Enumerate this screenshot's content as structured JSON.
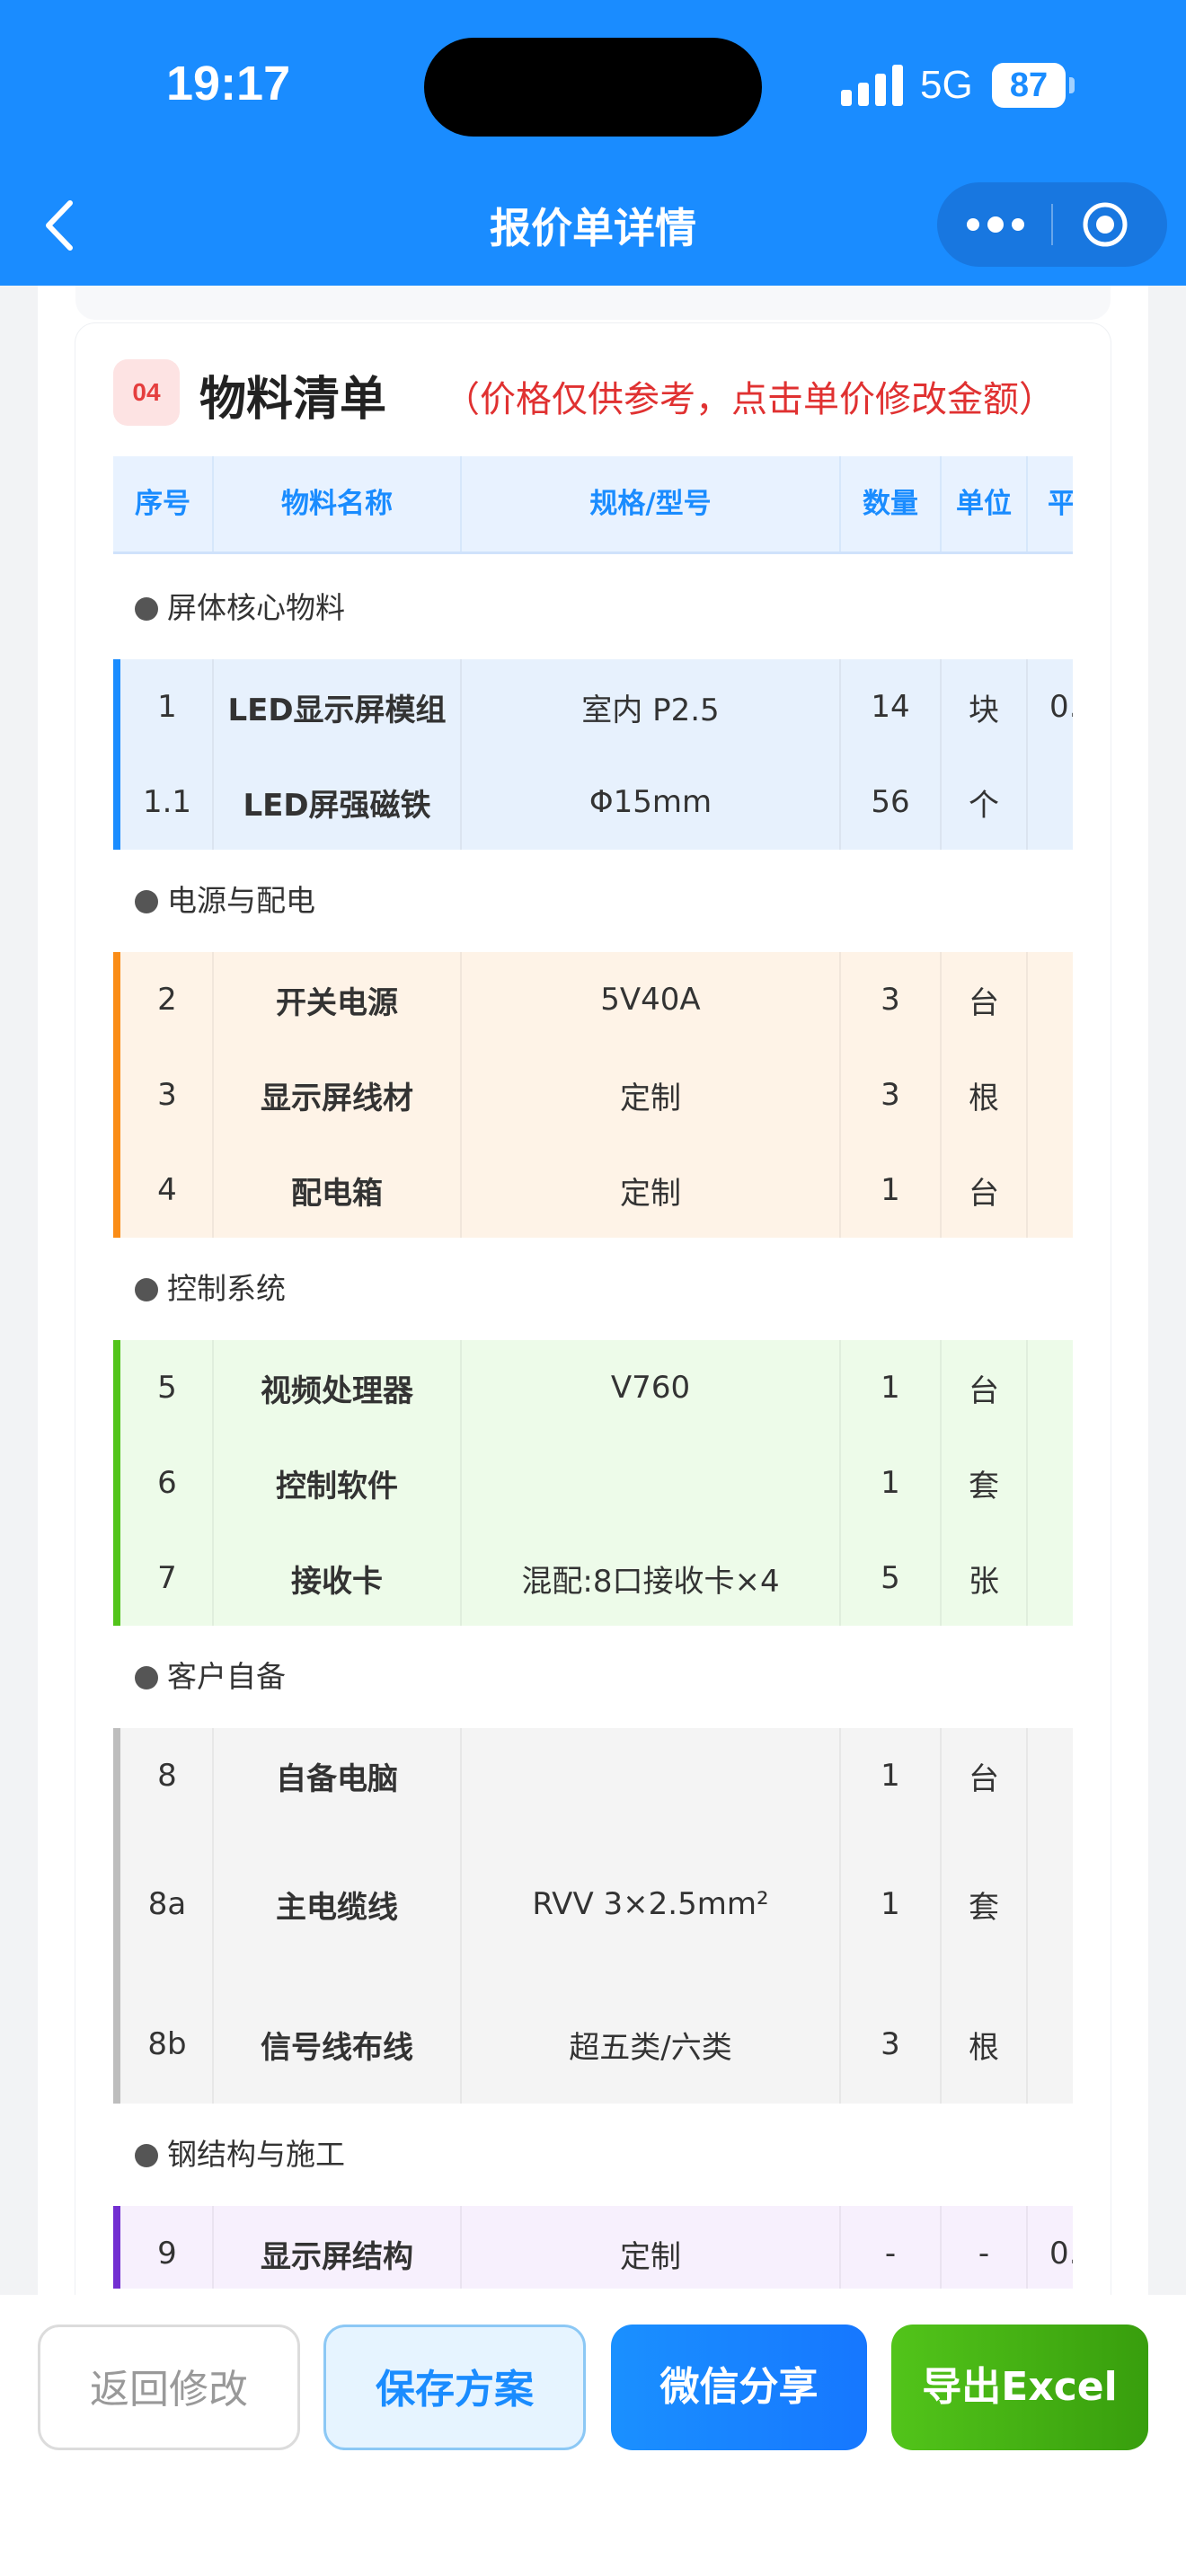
{
  "status": {
    "time": "19:17",
    "network": "5G",
    "battery": "87"
  },
  "nav": {
    "title": "报价单详情"
  },
  "section": {
    "badge": "04",
    "title": "物料清单",
    "note": "（价格仅供参考，点击单价修改金额）",
    "columns": [
      "序号",
      "物料名称",
      "规格/型号",
      "数量",
      "单位",
      "平"
    ]
  },
  "groups": [
    {
      "label": "屏体核心物料",
      "accent": "#1a8cff",
      "bg": "#e7f1fd",
      "rows": [
        {
          "no": "1",
          "name": "LED显示屏模组",
          "spec": "室内 P2.5",
          "qty": "14",
          "unit": "块",
          "price": "0."
        },
        {
          "no": "1.1",
          "name": "LED屏强磁铁",
          "spec": "Φ15mm",
          "qty": "56",
          "unit": "个",
          "price": ""
        }
      ]
    },
    {
      "label": "电源与配电",
      "accent": "#fa8c16",
      "bg": "#fef3e7",
      "rows": [
        {
          "no": "2",
          "name": "开关电源",
          "spec": "5V40A",
          "qty": "3",
          "unit": "台",
          "price": ""
        },
        {
          "no": "3",
          "name": "显示屏线材",
          "spec": "定制",
          "qty": "3",
          "unit": "根",
          "price": ""
        },
        {
          "no": "4",
          "name": "配电箱",
          "spec": "定制",
          "qty": "1",
          "unit": "台",
          "price": ""
        }
      ]
    },
    {
      "label": "控制系统",
      "accent": "#52c41a",
      "bg": "#edfbe9",
      "rows": [
        {
          "no": "5",
          "name": "视频处理器",
          "spec": "V760",
          "qty": "1",
          "unit": "台",
          "price": ""
        },
        {
          "no": "6",
          "name": "控制软件",
          "spec": "",
          "qty": "1",
          "unit": "套",
          "price": ""
        },
        {
          "no": "7",
          "name": "接收卡",
          "spec": "混配:8口接收卡×4",
          "qty": "5",
          "unit": "张",
          "price": ""
        }
      ]
    },
    {
      "label": "客户自备",
      "accent": "#bdbdbd",
      "bg": "#f4f4f4",
      "rows": [
        {
          "no": "8",
          "name": "自备电脑",
          "spec": "",
          "qty": "1",
          "unit": "台",
          "price": ""
        },
        {
          "no": "8a",
          "name": "主电缆线",
          "spec": "RVV 3×2.5mm²",
          "qty": "1",
          "unit": "套",
          "price": ""
        },
        {
          "no": "8b",
          "name": "信号线布线",
          "spec": "超五类/六类",
          "qty": "3",
          "unit": "根",
          "price": ""
        }
      ]
    },
    {
      "label": "钢结构与施工",
      "accent": "#722ed1",
      "bg": "#f7f0fd",
      "rows": [
        {
          "no": "9",
          "name": "显示屏结构",
          "spec": "定制",
          "qty": "-",
          "unit": "-",
          "price": "0."
        }
      ]
    }
  ],
  "actions": {
    "back": "返回修改",
    "save": "保存方案",
    "share": "微信分享",
    "export": "导出Excel"
  }
}
